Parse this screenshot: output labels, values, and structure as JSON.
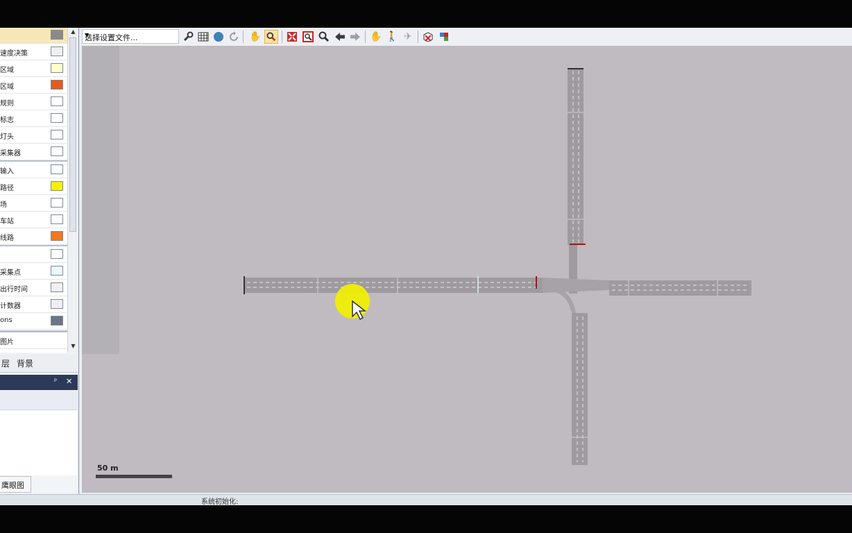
{
  "layers": [
    {
      "label": "",
      "swatch": "#8a8a8a",
      "selected": true
    },
    {
      "label": "速度决策",
      "swatch": "#f0f0f0"
    },
    {
      "label": "区域",
      "swatch": "#ffffcc"
    },
    {
      "label": "区域",
      "swatch": "#e25a1c"
    },
    {
      "label": "规则",
      "swatch": "#ffffff"
    },
    {
      "label": "标志",
      "swatch": "#ffffff"
    },
    {
      "label": "灯头",
      "swatch": "#ffffff"
    },
    {
      "label": "采集器",
      "swatch": "#ffffff"
    },
    {
      "label": "输入",
      "swatch": "#ffffff"
    },
    {
      "label": "路径",
      "swatch": "#f7f000"
    },
    {
      "label": "场",
      "swatch": "#ffffff"
    },
    {
      "label": "车站",
      "swatch": "#ffffff"
    },
    {
      "label": "线路",
      "swatch": "#f07820"
    },
    {
      "label": "",
      "swatch": "#ffffff"
    },
    {
      "label": "采集点",
      "swatch": "#e9f9ff"
    },
    {
      "label": "出行时间",
      "swatch": "#f0f0f0"
    },
    {
      "label": "计数器",
      "swatch": "#f2ecf5"
    },
    {
      "label": "ons",
      "swatch": "#6c7686"
    },
    {
      "label": "图片",
      "swatch": ""
    }
  ],
  "tabs": [
    "层",
    "背景"
  ],
  "birdseye_tab": "鹰眼图",
  "toolbar": {
    "config_combo": "选择设置文件...",
    "icons": [
      "wrench-icon",
      "grid-icon",
      "globe-icon",
      "refresh-icon",
      "hand-icon",
      "zoom-select-icon",
      "zoom-all-icon",
      "zoom-rect-icon",
      "zoom-icon",
      "back-icon",
      "forward-icon",
      "pan-icon",
      "walk-icon",
      "airplane-icon",
      "cube-delete-icon",
      "3d-view-icon"
    ]
  },
  "map": {
    "scale_label": "50 m"
  },
  "status": {
    "text": "系统初始化:"
  }
}
